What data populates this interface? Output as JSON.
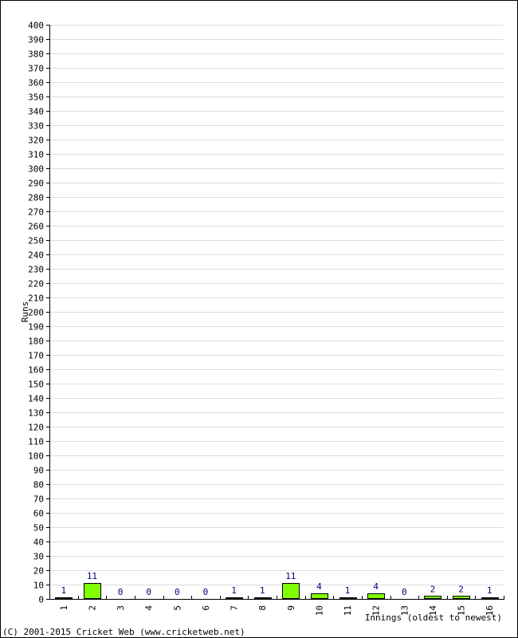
{
  "chart_data": {
    "type": "bar",
    "title": "",
    "xlabel": "Innings (oldest to newest)",
    "ylabel": "Runs",
    "ylim": [
      0,
      400
    ],
    "ytick_step": 10,
    "grid": true,
    "categories": [
      "1",
      "2",
      "3",
      "4",
      "5",
      "6",
      "7",
      "8",
      "9",
      "10",
      "11",
      "12",
      "13",
      "14",
      "15",
      "16"
    ],
    "values": [
      1,
      11,
      0,
      0,
      0,
      0,
      1,
      1,
      11,
      4,
      1,
      4,
      0,
      2,
      2,
      1
    ],
    "bar_color": "#80ff00",
    "label_color": "#000080",
    "grid_color": "#dddddd"
  },
  "footer": {
    "copyright": "(C) 2001-2015 Cricket Web (www.cricketweb.net)"
  }
}
